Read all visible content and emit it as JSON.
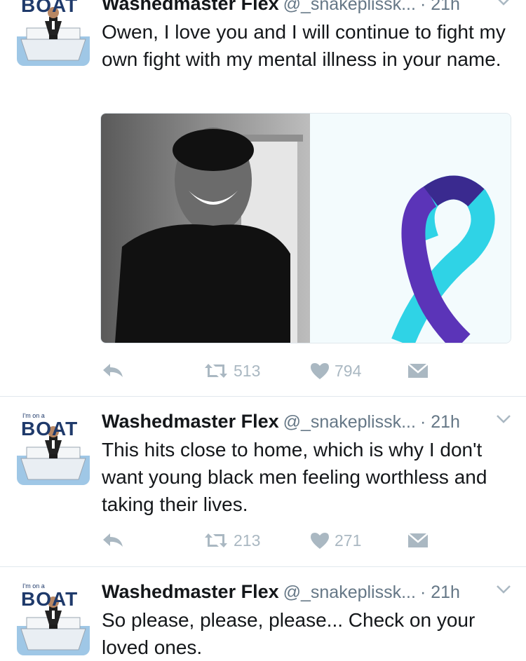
{
  "tweets": [
    {
      "name": "Washedmaster Flex",
      "handle": "@_snakeplissk...",
      "time": "· 21h",
      "text": "Owen, I love you and I will continue to fight my own fight with my mental illness in your name.",
      "retweets": "513",
      "likes": "794"
    },
    {
      "name": "Washedmaster Flex",
      "handle": "@_snakeplissk...",
      "time": "· 21h",
      "text": "This hits close to home, which is why I don't want young black men feeling worthless and taking their lives.",
      "retweets": "213",
      "likes": "271"
    },
    {
      "name": "Washedmaster Flex",
      "handle": "@_snakeplissk...",
      "time": "· 21h",
      "text": "So please, please, please... Check on your loved ones."
    }
  ],
  "avatar": {
    "small_text": "I'm on a",
    "big_text": "BOAT"
  },
  "colors": {
    "icon_gray": "#aab8c2",
    "handle_gray": "#657786",
    "ribbon_purple": "#5b34b8",
    "ribbon_teal": "#2fd3e6"
  }
}
